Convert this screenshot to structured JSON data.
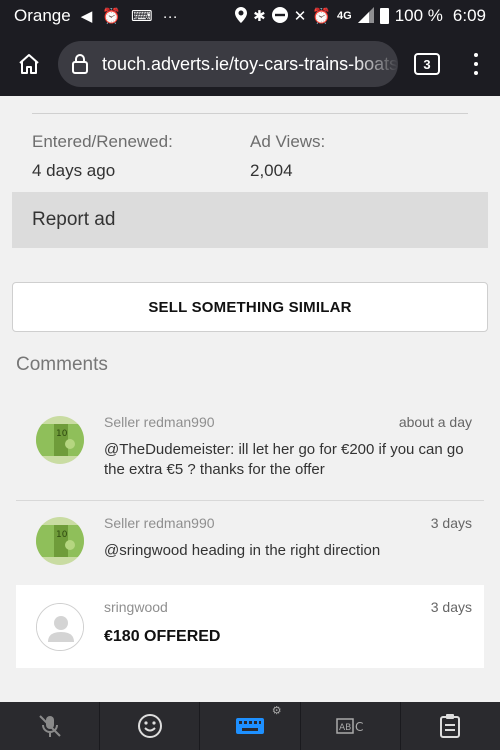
{
  "status_bar": {
    "carrier": "Orange",
    "network": "4G",
    "battery": "100 %",
    "time": "6:09"
  },
  "browser": {
    "url": "touch.adverts.ie/toy-cars-trains-boats",
    "tab_count": "3"
  },
  "ad_meta": {
    "entered_label": "Entered/Renewed:",
    "entered_value": "4 days ago",
    "views_label": "Ad Views:",
    "views_value": "2,004"
  },
  "report_label": "Report ad",
  "sell_button_label": "SELL SOMETHING SIMILAR",
  "comments": {
    "title": "Comments",
    "items": [
      {
        "author": "Seller redman990",
        "time": "about a day",
        "text": "@TheDudemeister: ill let her go for €200 if you can go the extra €5 ? thanks for the offer"
      },
      {
        "author": "Seller redman990",
        "time": "3 days",
        "text": "@sringwood heading in the right direction"
      },
      {
        "author": "sringwood",
        "time": "3 days",
        "text": "€180 OFFERED"
      }
    ]
  },
  "colors": {
    "browser_bar": "#1c1c22",
    "page_bg": "#f1f1f1",
    "report_bg": "#dcdcdc",
    "keyboard_accent": "#1e90ff"
  },
  "icons": {
    "home": "home-icon",
    "lock": "lock-icon",
    "mic_off": "mic-off-icon",
    "emoji": "emoji-icon",
    "keyboard": "keyboard-icon",
    "text_select": "text-select-icon",
    "clipboard": "clipboard-icon"
  }
}
